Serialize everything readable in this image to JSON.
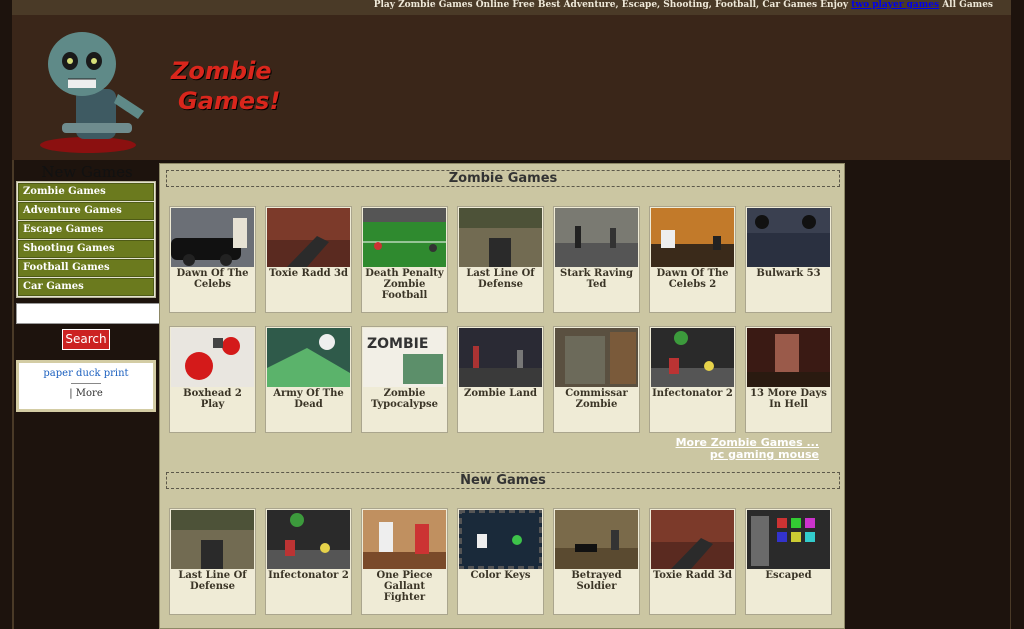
{
  "topbar": {
    "text_before": "Play Zombie Games Online Free Best Adventure, Escape, Shooting, Football, Car Games Enjoy",
    "link": "two player games",
    "text_after": "All Games"
  },
  "logo": {
    "line1": "Zombie",
    "line2": "Games!"
  },
  "sidebar": {
    "title": "New Games",
    "categories": [
      "Zombie Games",
      "Adventure Games",
      "Escape Games",
      "Shooting Games",
      "Football Games",
      "Car Games"
    ],
    "search_value": "",
    "search_button": "Search",
    "link1": "paper duck print",
    "link2": "| More"
  },
  "sections": [
    {
      "title": "Zombie Games",
      "games": [
        {
          "title": "Dawn Of The Celebs",
          "art": "car"
        },
        {
          "title": "Toxie Radd 3d",
          "art": "gun"
        },
        {
          "title": "Death Penalty Zombie Football",
          "art": "football"
        },
        {
          "title": "Last Line Of Defense",
          "art": "turret"
        },
        {
          "title": "Stark Raving Ted",
          "art": "street"
        },
        {
          "title": "Dawn Of The Celebs 2",
          "art": "sunset"
        },
        {
          "title": "Bulwark 53",
          "art": "topdown"
        },
        {
          "title": "Boxhead 2 Play",
          "art": "blood"
        },
        {
          "title": "Army Of The Dead",
          "art": "green"
        },
        {
          "title": "Zombie Typocalypse",
          "art": "typo"
        },
        {
          "title": "Zombie Land",
          "art": "dark"
        },
        {
          "title": "Commissar Zombie",
          "art": "crate"
        },
        {
          "title": "Infectonator 2",
          "art": "infect"
        },
        {
          "title": "13 More Days In Hell",
          "art": "hell"
        }
      ]
    },
    {
      "title": "New Games",
      "games": [
        {
          "title": "Last Line Of Defense",
          "art": "turret"
        },
        {
          "title": "Infectonator 2",
          "art": "infect"
        },
        {
          "title": "One Piece Gallant Fighter",
          "art": "piece"
        },
        {
          "title": "Color Keys",
          "art": "keys"
        },
        {
          "title": "Betrayed Soldier",
          "art": "soldier"
        },
        {
          "title": "Toxie Radd 3d",
          "art": "gun"
        },
        {
          "title": "Escaped",
          "art": "escaped"
        }
      ]
    }
  ],
  "more_links": [
    "More Zombie Games ...",
    "pc gaming mouse"
  ]
}
